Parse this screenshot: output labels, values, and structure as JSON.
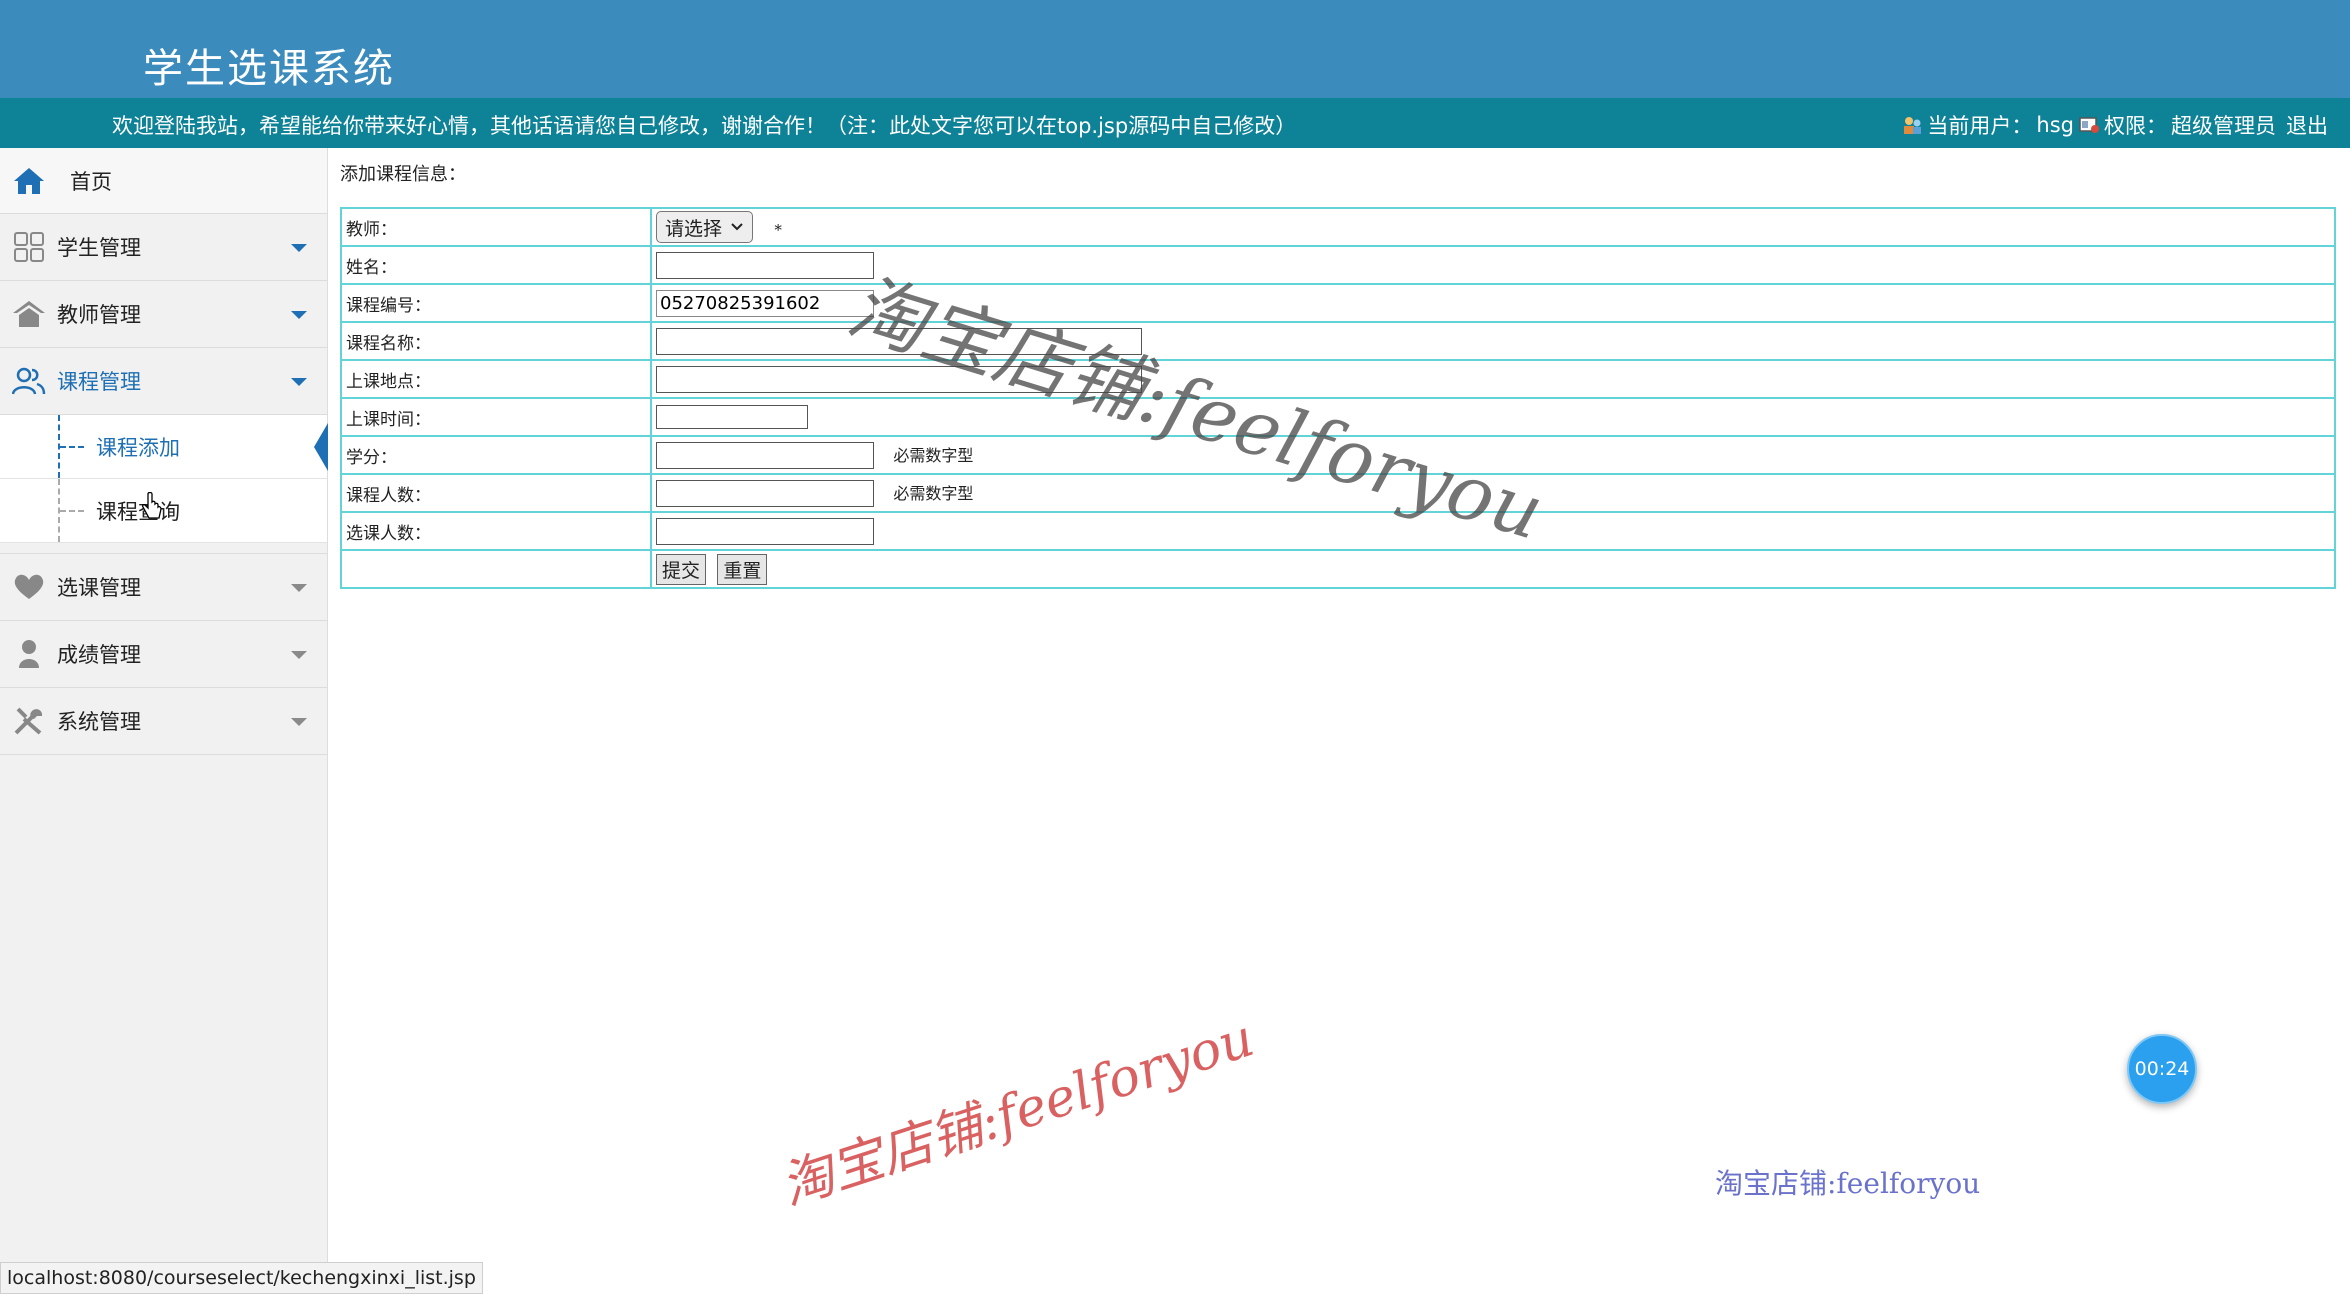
{
  "header": {
    "title": "学生选课系统",
    "welcome": "欢迎登陆我站，希望能给你带来好心情，其他话语请您自己修改，谢谢合作！（注：此处文字您可以在top.jsp源码中自己修改）",
    "current_user_label": "当前用户：",
    "current_user": "hsg",
    "role_label": "权限：",
    "role": "超级管理员",
    "logout": "退出"
  },
  "sidebar": {
    "home": "首页",
    "items": [
      {
        "label": "学生管理",
        "icon": "grid-icon"
      },
      {
        "label": "教师管理",
        "icon": "house-icon"
      },
      {
        "label": "课程管理",
        "icon": "users-icon",
        "active": true,
        "children": [
          {
            "label": "课程添加",
            "active": true
          },
          {
            "label": "课程查询"
          }
        ]
      },
      {
        "label": "选课管理",
        "icon": "heart-icon"
      },
      {
        "label": "成绩管理",
        "icon": "person-icon"
      },
      {
        "label": "系统管理",
        "icon": "tools-icon"
      }
    ]
  },
  "form": {
    "caption": "添加课程信息：",
    "teacher_label": "教师：",
    "teacher_selected": "请选择",
    "required_star": "*",
    "name_label": "姓名：",
    "name_value": "",
    "code_label": "课程编号：",
    "code_value": "05270825391602",
    "course_name_label": "课程名称：",
    "course_name_value": "",
    "location_label": "上课地点：",
    "location_value": "",
    "time_label": "上课时间：",
    "time_value": "",
    "credit_label": "学分：",
    "credit_value": "",
    "numeric_hint": "必需数字型",
    "capacity_label": "课程人数：",
    "capacity_value": "",
    "enrolled_label": "选课人数：",
    "enrolled_value": "",
    "submit": "提交",
    "reset": "重置"
  },
  "watermarks": {
    "text1": "淘宝店铺:feelforyou",
    "text2": "淘宝店铺:feelforyou",
    "text3": "淘宝店铺:feelforyou"
  },
  "timer": "00:24",
  "status_url": "localhost:8080/courseselect/kechengxinxi_list.jsp",
  "colors": {
    "header_bg": "#3b8bbd",
    "topbar_bg": "#0e8297",
    "accent": "#1e6fb3",
    "table_border": "#62d4d8"
  }
}
